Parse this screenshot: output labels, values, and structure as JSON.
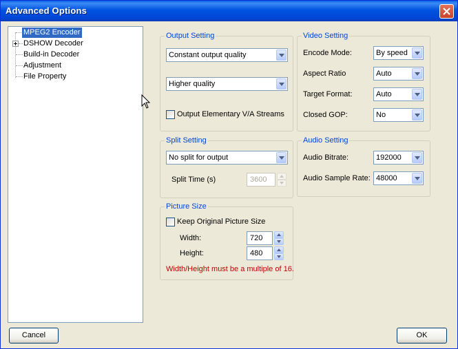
{
  "window": {
    "title": "Advanced Options"
  },
  "tree": {
    "items": [
      {
        "label": "MPEG2 Encoder",
        "selected": true
      },
      {
        "label": "DSHOW Decoder",
        "expandable": true
      },
      {
        "label": "Build-in Decoder"
      },
      {
        "label": "Adjustment"
      },
      {
        "label": "File Property"
      }
    ]
  },
  "output_setting": {
    "title": "Output Setting",
    "quality_mode": "Constant output quality",
    "quality_level": "Higher quality",
    "elementary_streams_label": "Output Elementary V/A Streams",
    "elementary_streams_checked": false
  },
  "video_setting": {
    "title": "Video Setting",
    "encode_mode_label": "Encode Mode:",
    "encode_mode": "By speed",
    "aspect_ratio_label": "Aspect Ratio",
    "aspect_ratio": "Auto",
    "target_format_label": "Target Format:",
    "target_format": "Auto",
    "closed_gop_label": "Closed GOP:",
    "closed_gop": "No"
  },
  "split_setting": {
    "title": "Split Setting",
    "split_mode": "No split for output",
    "split_time_label": "Split Time (s)",
    "split_time": "3600"
  },
  "audio_setting": {
    "title": "Audio Setting",
    "bitrate_label": "Audio Bitrate:",
    "bitrate": "192000",
    "sample_rate_label": "Audio Sample Rate:",
    "sample_rate": "48000"
  },
  "picture_size": {
    "title": "Picture Size",
    "keep_original_label": "Keep Original Picture Size",
    "keep_original_checked": false,
    "width_label": "Width:",
    "width": "720",
    "height_label": "Height:",
    "height": "480",
    "warning": "Width/Height must be a multiple of 16."
  },
  "buttons": {
    "cancel": "Cancel",
    "ok": "OK"
  },
  "colors": {
    "titlebar": "#0053e1",
    "selection": "#316ac5",
    "group_title": "#0046d5",
    "warning": "#c00000"
  }
}
